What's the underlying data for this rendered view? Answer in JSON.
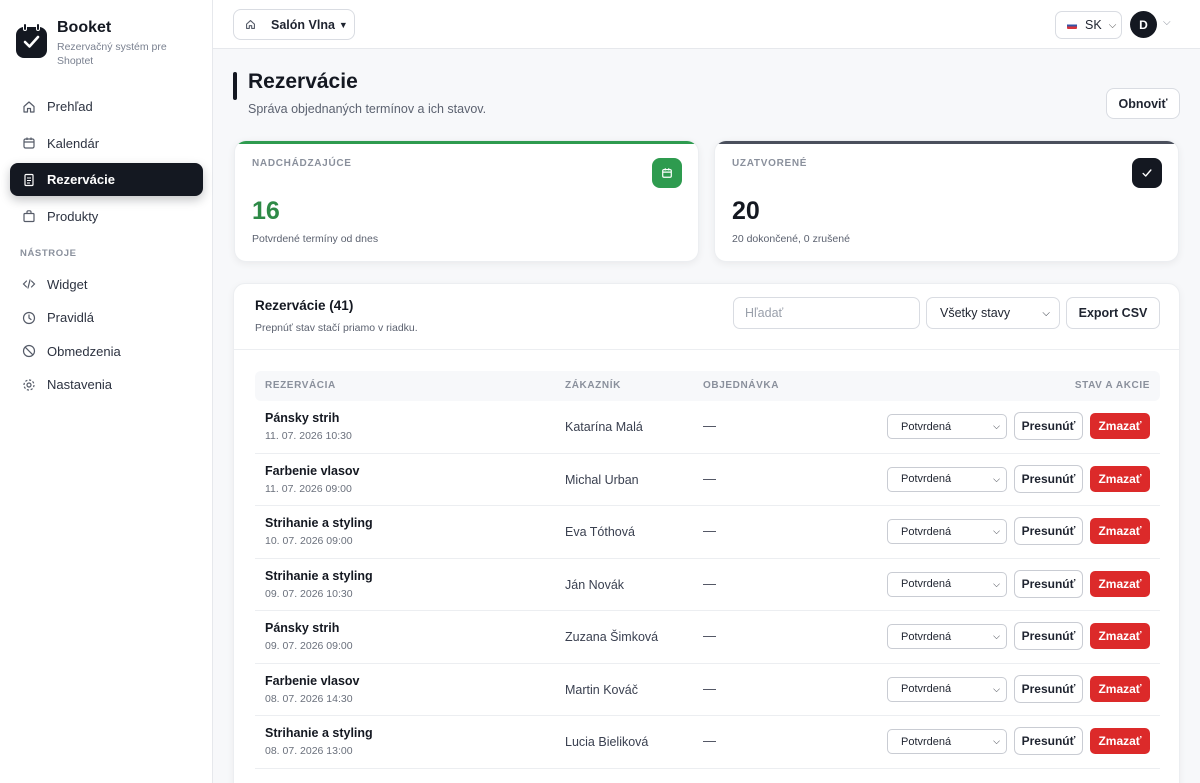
{
  "app": {
    "name": "Booket",
    "subtitle": "Rezervačný systém pre Shoptet"
  },
  "sidebar": {
    "main_items": [
      {
        "label": "Prehľad",
        "icon": "home-icon"
      },
      {
        "label": "Kalendár",
        "icon": "calendar-icon"
      },
      {
        "label": "Rezervácie",
        "icon": "document-icon",
        "active": true
      },
      {
        "label": "Produkty",
        "icon": "bag-icon"
      }
    ],
    "section_label": "NÁSTROJE",
    "tool_items": [
      {
        "label": "Widget",
        "icon": "code-icon"
      },
      {
        "label": "Pravidlá",
        "icon": "clock-icon"
      },
      {
        "label": "Obmedzenia",
        "icon": "ban-icon"
      },
      {
        "label": "Nastavenia",
        "icon": "gear-icon"
      }
    ]
  },
  "topbar": {
    "salon": "Salón Vlna",
    "language": "SK",
    "avatar_initial": "D"
  },
  "page": {
    "title": "Rezervácie",
    "subtitle": "Správa objednaných termínov a ich stavov.",
    "refresh_label": "Obnoviť"
  },
  "stats": {
    "upcoming": {
      "label": "NADCHÁDZAJÚCE",
      "value": "16",
      "description": "Potvrdené termíny od dnes",
      "color": "#2e9b4f"
    },
    "closed": {
      "label": "UZATVORENÉ",
      "value": "20",
      "description": "20 dokončené, 0 zrušené",
      "color": "#141821"
    }
  },
  "table": {
    "title": "Rezervácie (41)",
    "subtitle": "Prepnúť stav stačí priamo v riadku.",
    "search_placeholder": "Hľadať",
    "filter_value": "Všetky stavy",
    "export_label": "Export CSV",
    "columns": {
      "reservation": "REZERVÁCIA",
      "customer": "ZÁKAZNÍK",
      "order": "OBJEDNÁVKA",
      "actions": "STAV A AKCIE"
    },
    "move_label": "Presunúť",
    "delete_label": "Zmazať",
    "delete_color": "#dc2a2a",
    "rows": [
      {
        "service": "Pánsky strih",
        "datetime": "11. 07. 2026 10:30",
        "customer": "Katarína Malá",
        "order": "—",
        "status": "Potvrdená"
      },
      {
        "service": "Farbenie vlasov",
        "datetime": "11. 07. 2026 09:00",
        "customer": "Michal Urban",
        "order": "—",
        "status": "Potvrdená"
      },
      {
        "service": "Strihanie a styling",
        "datetime": "10. 07. 2026 09:00",
        "customer": "Eva Tóthová",
        "order": "—",
        "status": "Potvrdená"
      },
      {
        "service": "Strihanie a styling",
        "datetime": "09. 07. 2026 10:30",
        "customer": "Ján Novák",
        "order": "—",
        "status": "Potvrdená"
      },
      {
        "service": "Pánsky strih",
        "datetime": "09. 07. 2026 09:00",
        "customer": "Zuzana Šimková",
        "order": "—",
        "status": "Potvrdená"
      },
      {
        "service": "Farbenie vlasov",
        "datetime": "08. 07. 2026 14:30",
        "customer": "Martin Kováč",
        "order": "—",
        "status": "Potvrdená"
      },
      {
        "service": "Strihanie a styling",
        "datetime": "08. 07. 2026 13:00",
        "customer": "Lucia Bieliková",
        "order": "—",
        "status": "Potvrdená"
      }
    ]
  }
}
